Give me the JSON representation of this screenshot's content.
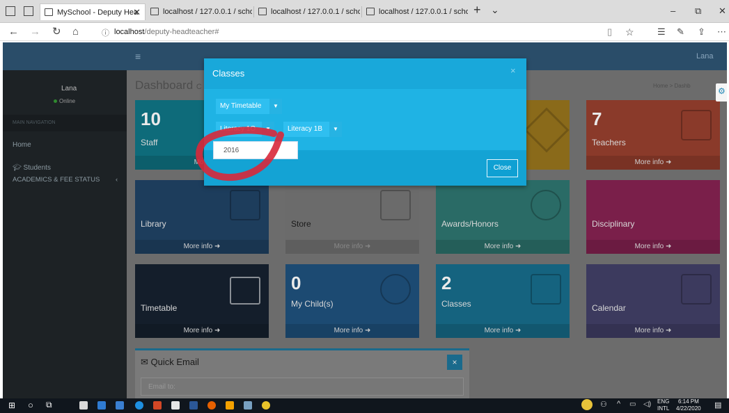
{
  "browser": {
    "tabs": [
      {
        "label": "MySchool - Deputy Hea",
        "active": true
      },
      {
        "label": "localhost / 127.0.0.1 / schoc",
        "active": false
      },
      {
        "label": "localhost / 127.0.0.1 / schoc",
        "active": false
      },
      {
        "label": "localhost / 127.0.0.1 / schoc",
        "active": false
      }
    ],
    "new_tab": "+",
    "tab_menu": "⌄",
    "url_host": "localhost",
    "url_path": "/deputy-headteacher#",
    "window_controls": {
      "minimize": "–",
      "restore": "⧉",
      "close": "✕"
    }
  },
  "app": {
    "topnav": {
      "menu_icon": "≡",
      "user": "Lana"
    },
    "sidebar": {
      "user_name": "Lana",
      "status": "Online",
      "section_header": "MAIN NAVIGATION",
      "items": [
        {
          "label": "Home"
        },
        {
          "label": "Students"
        },
        {
          "label": "ACADEMICS & FEE STATUS"
        }
      ]
    },
    "content": {
      "title": "Dashboard",
      "subtitle": "C",
      "breadcrumb": [
        "Home",
        "Dashb"
      ],
      "boxes": [
        {
          "num": "10",
          "label": "Staff",
          "foot": "More",
          "color": "#0e6b7a"
        },
        {
          "num": "",
          "label": "",
          "foot": "",
          "color": "#7b6b3a"
        },
        {
          "num": "",
          "label": "",
          "foot": "",
          "color": "#8a6a1a"
        },
        {
          "num": "7",
          "label": "Teachers",
          "foot": "More info",
          "color": "#8a3a2a"
        },
        {
          "num": "",
          "label": "Library",
          "foot": "More info",
          "color": "#1d3d5c"
        },
        {
          "num": "",
          "label": "Store",
          "foot": "More info",
          "color": "#6b6b6b"
        },
        {
          "num": "",
          "label": "Awards/Honors",
          "foot": "More info",
          "color": "#2a6b66"
        },
        {
          "num": "",
          "label": "Disciplinary",
          "foot": "More info",
          "color": "#7a1f4a"
        },
        {
          "num": "",
          "label": "Timetable",
          "foot": "More info",
          "color": "#141e2b"
        },
        {
          "num": "0",
          "label": "My Child(s)",
          "foot": "More info",
          "color": "#1c4a72"
        },
        {
          "num": "2",
          "label": "Classes",
          "foot": "More info",
          "color": "#15637f"
        },
        {
          "num": "",
          "label": "Calendar",
          "foot": "More info",
          "color": "#3c3a5e"
        }
      ],
      "quick_email": {
        "title": "Quick Email",
        "close": "×",
        "email_placeholder": "Email to:"
      }
    }
  },
  "modal": {
    "title": "Classes",
    "close_x": "×",
    "my_timetable": "My Timetable",
    "class_a": "Literacy 1O",
    "class_b": "Literacy 1B",
    "year": "2016",
    "close_button": "Close",
    "annotation_color": "#d8283a"
  },
  "taskbar": {
    "lang": "ENG",
    "lang2": "INTL",
    "time": "6:14 PM",
    "date": "4/22/2020"
  }
}
